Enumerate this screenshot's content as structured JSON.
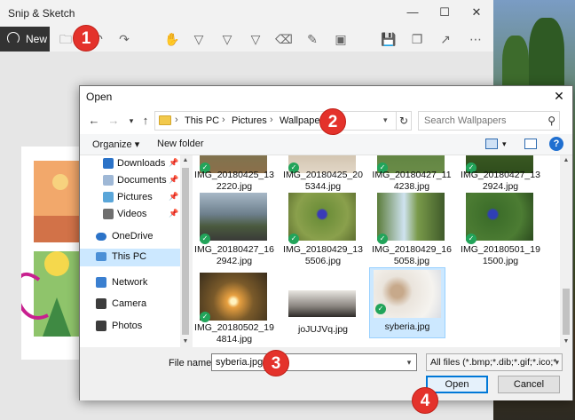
{
  "app": {
    "title": "Snip & Sketch",
    "new_label": "New"
  },
  "callouts": [
    "1",
    "2",
    "3",
    "4"
  ],
  "dialog": {
    "title": "Open",
    "breadcrumb": [
      "This PC",
      "Pictures",
      "Wallpapers"
    ],
    "search_placeholder": "Search Wallpapers",
    "organize_label": "Organize ▾",
    "new_folder_label": "New folder",
    "nav_items": [
      {
        "label": "Downloads",
        "pinned": true
      },
      {
        "label": "Documents",
        "pinned": true
      },
      {
        "label": "Pictures",
        "pinned": true
      },
      {
        "label": "Videos",
        "pinned": true
      },
      {
        "label": "OneDrive",
        "pinned": false
      },
      {
        "label": "This PC",
        "pinned": false,
        "selected": true
      },
      {
        "label": "Network",
        "pinned": false
      },
      {
        "label": "Camera",
        "pinned": false
      },
      {
        "label": "Photos",
        "pinned": false
      }
    ],
    "files": [
      {
        "name_l1": "IMG_20180425_13",
        "name_l2": "2220.jpg"
      },
      {
        "name_l1": "IMG_20180425_20",
        "name_l2": "5344.jpg"
      },
      {
        "name_l1": "IMG_20180427_11",
        "name_l2": "4238.jpg"
      },
      {
        "name_l1": "IMG_20180427_13",
        "name_l2": "2924.jpg"
      },
      {
        "name_l1": "IMG_20180427_16",
        "name_l2": "2942.jpg"
      },
      {
        "name_l1": "IMG_20180429_13",
        "name_l2": "5506.jpg"
      },
      {
        "name_l1": "IMG_20180429_16",
        "name_l2": "5058.jpg"
      },
      {
        "name_l1": "IMG_20180501_19",
        "name_l2": "1500.jpg"
      },
      {
        "name_l1": "IMG_20180502_19",
        "name_l2": "4814.jpg"
      },
      {
        "name_l1": "joJUJVq.jpg",
        "name_l2": ""
      },
      {
        "name_l1": "syberia.jpg",
        "name_l2": "",
        "selected": true
      }
    ],
    "file_name_label": "File name:",
    "file_name_value": "syberia.jpg",
    "file_type": "All files (*.bmp;*.dib;*.gif;*.ico;*",
    "open_label": "Open",
    "cancel_label": "Cancel"
  },
  "colors": {
    "accent": "#0078d7",
    "callout": "#e4322b",
    "selection": "#cce8ff",
    "check": "#22a45a"
  }
}
